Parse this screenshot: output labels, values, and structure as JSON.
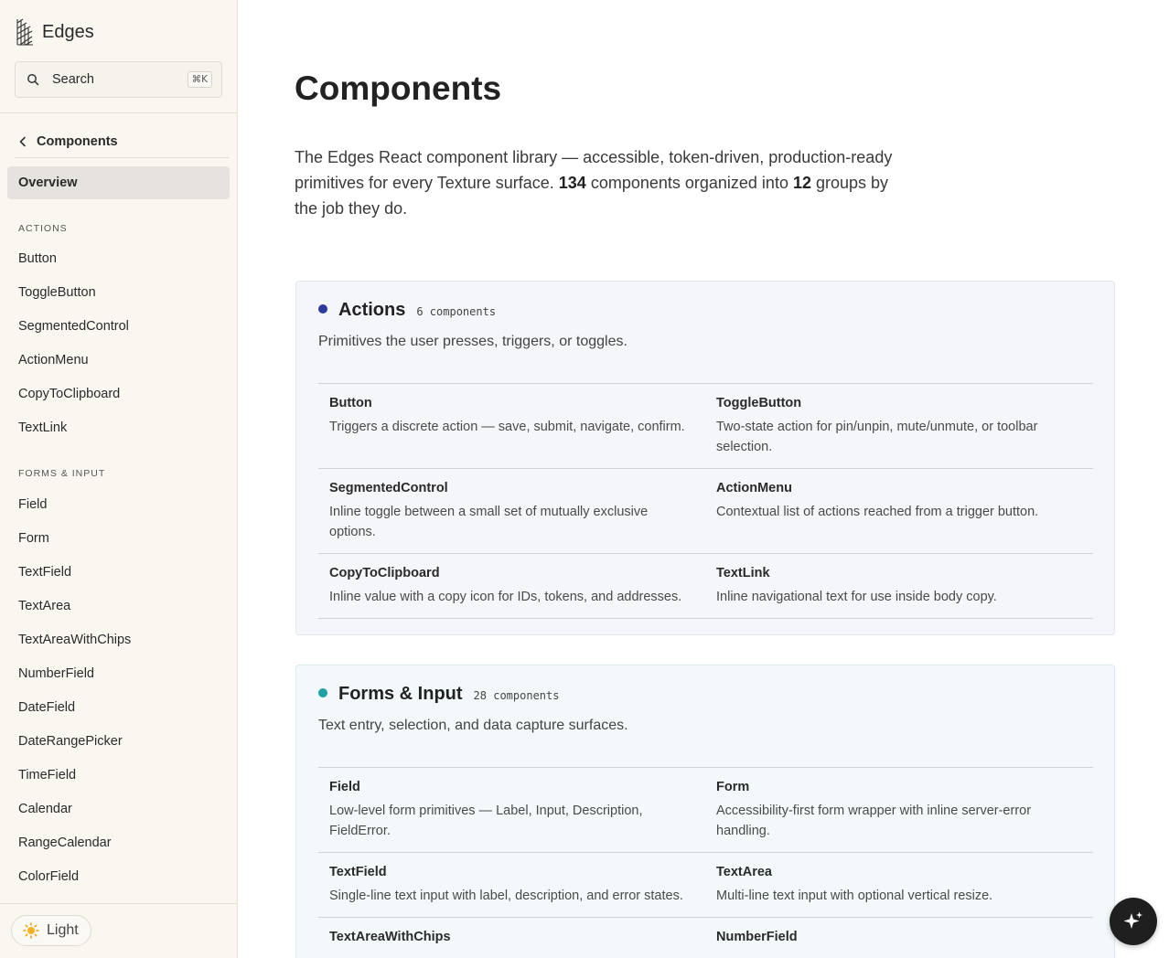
{
  "brand": {
    "name": "Edges"
  },
  "search": {
    "label": "Search",
    "shortcut": "⌘K"
  },
  "nav": {
    "back_label": "Components",
    "overview": "Overview",
    "sections": [
      {
        "label": "ACTIONS",
        "items": [
          "Button",
          "ToggleButton",
          "SegmentedControl",
          "ActionMenu",
          "CopyToClipboard",
          "TextLink"
        ]
      },
      {
        "label": "FORMS & INPUT",
        "items": [
          "Field",
          "Form",
          "TextField",
          "TextArea",
          "TextAreaWithChips",
          "NumberField",
          "DateField",
          "DateRangePicker",
          "TimeField",
          "Calendar",
          "RangeCalendar",
          "ColorField"
        ]
      }
    ]
  },
  "theme": {
    "label": "Light",
    "icon": "sun-icon"
  },
  "page": {
    "title": "Components",
    "intro_before": "The Edges React component library — accessible, token-driven, production-ready primitives for every Texture surface. ",
    "component_count": "134",
    "intro_middle": " components organized into ",
    "group_count": "12",
    "intro_after": " groups by the job they do."
  },
  "groups": [
    {
      "title": "Actions",
      "count": "6 components",
      "color": "#2f3b9c",
      "description": "Primitives the user presses, triggers, or toggles.",
      "items": [
        {
          "name": "Button",
          "desc": "Triggers a discrete action — save, submit, navigate, confirm."
        },
        {
          "name": "ToggleButton",
          "desc": "Two-state action for pin/unpin, mute/unmute, or toolbar selection."
        },
        {
          "name": "SegmentedControl",
          "desc": "Inline toggle between a small set of mutually exclusive options."
        },
        {
          "name": "ActionMenu",
          "desc": "Contextual list of actions reached from a trigger button."
        },
        {
          "name": "CopyToClipboard",
          "desc": "Inline value with a copy icon for IDs, tokens, and addresses."
        },
        {
          "name": "TextLink",
          "desc": "Inline navigational text for use inside body copy."
        }
      ]
    },
    {
      "title": "Forms & Input",
      "count": "28 components",
      "color": "#1ba1a6",
      "description": "Text entry, selection, and data capture surfaces.",
      "items": [
        {
          "name": "Field",
          "desc": "Low-level form primitives — Label, Input, Description, FieldError."
        },
        {
          "name": "Form",
          "desc": "Accessibility-first form wrapper with inline server-error handling."
        },
        {
          "name": "TextField",
          "desc": "Single-line text input with label, description, and error states."
        },
        {
          "name": "TextArea",
          "desc": "Multi-line text input with optional vertical resize."
        },
        {
          "name": "TextAreaWithChips",
          "desc": ""
        },
        {
          "name": "NumberField",
          "desc": ""
        }
      ]
    }
  ],
  "assistant": {
    "icon": "sparkle-icon"
  }
}
